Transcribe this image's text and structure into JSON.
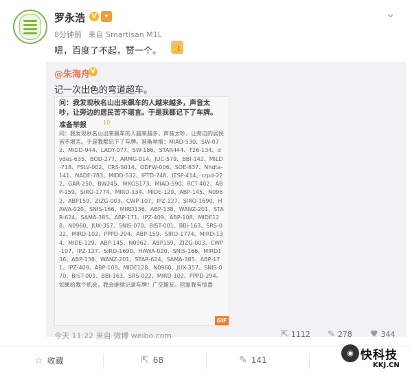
{
  "post": {
    "author": "罗永浩",
    "verified": "V",
    "time": "8分钟前",
    "source": "来自 Smartisan M1L",
    "text": "嗯，百度了不起，赞一个。",
    "thumb": "👍",
    "chevron": "⌄"
  },
  "repost": {
    "author": "@朱海舟",
    "verified": "V",
    "text": "记一次出色的弯道超车。",
    "screenshot": {
      "question": "问：我发现秋名山出来飙车的人越来越多，声音太吵，让旁边的居民苦不堪言。于是我都记下了车牌。",
      "tag": "准备举报",
      "count": "10",
      "body": "问：我发现秋名山出来飙车的人越来越多，声音太吵，让旁边的居民苦不堪言。于是我都记下了车牌。准备举报：MIAD-530、SW-072、MIDD-944、LADY-077、SW-186、STAR444、T26-134、dvdes-635、BOD-277、ARMG-014、JUC-579、BBI-142、MILD-718、FSLV-002、CRS-S014、ODFW-006、SOE-837、Nhdta-141、NADE-783、MIDD-532、IPTD-748、IESP-414、crpd-222、GAR-250、BW245、MXGS173、MIAD-590、RCT-402、ABP-159、SIRO-1774、MIRD-134、MIDE-129、ABP-145、N0962、ABP159、ZIZG-003、CWP-107、IPZ-127、SIRO-1690、HAWA-020、SNIS-166、MIRD136、ABP-138、WANZ-201、STAR-624、SAMA-385、ABP-171、IPZ-409、ABP-108、MIDE128、N0960、JUX-357、SNIS-070、BIST-001、BBI-163、SRS-022、MIRD-102、PPPD-294、ABP-159、SIRO-1774、MIRD-134、MIDE-129、ABP-145、N0962、ABP159、ZIZG-003、CWP-107、IPZ-127、SIRO-1690、HAWA-020、SNIS-166、MIRD136、ABP-138、WANZ-201、STAR-624、SAMA-385、ABP-171、IPZ-409、ABP-108、MIDE128、N0960、JUX-357、SNIS-070、BIST-001、BBI-163、SRS-022、MIRD-102、PPPD-294。如果给我个机会，我会继续记录车牌！广交盟友。回复我有惊喜",
      "gif": "GIF"
    },
    "timestamp": "今天 11:22 来自 微博 weibo.com",
    "actions": {
      "share_count": "1112",
      "comment_count": "278",
      "like_count": "344"
    }
  },
  "bar": {
    "favorite": "收藏",
    "share_count": "68",
    "comment_count": "141",
    "like_count": "",
    "favorite_icon": "☆"
  },
  "watermark": {
    "title": "快科技",
    "sub": "KKJ.CN"
  }
}
